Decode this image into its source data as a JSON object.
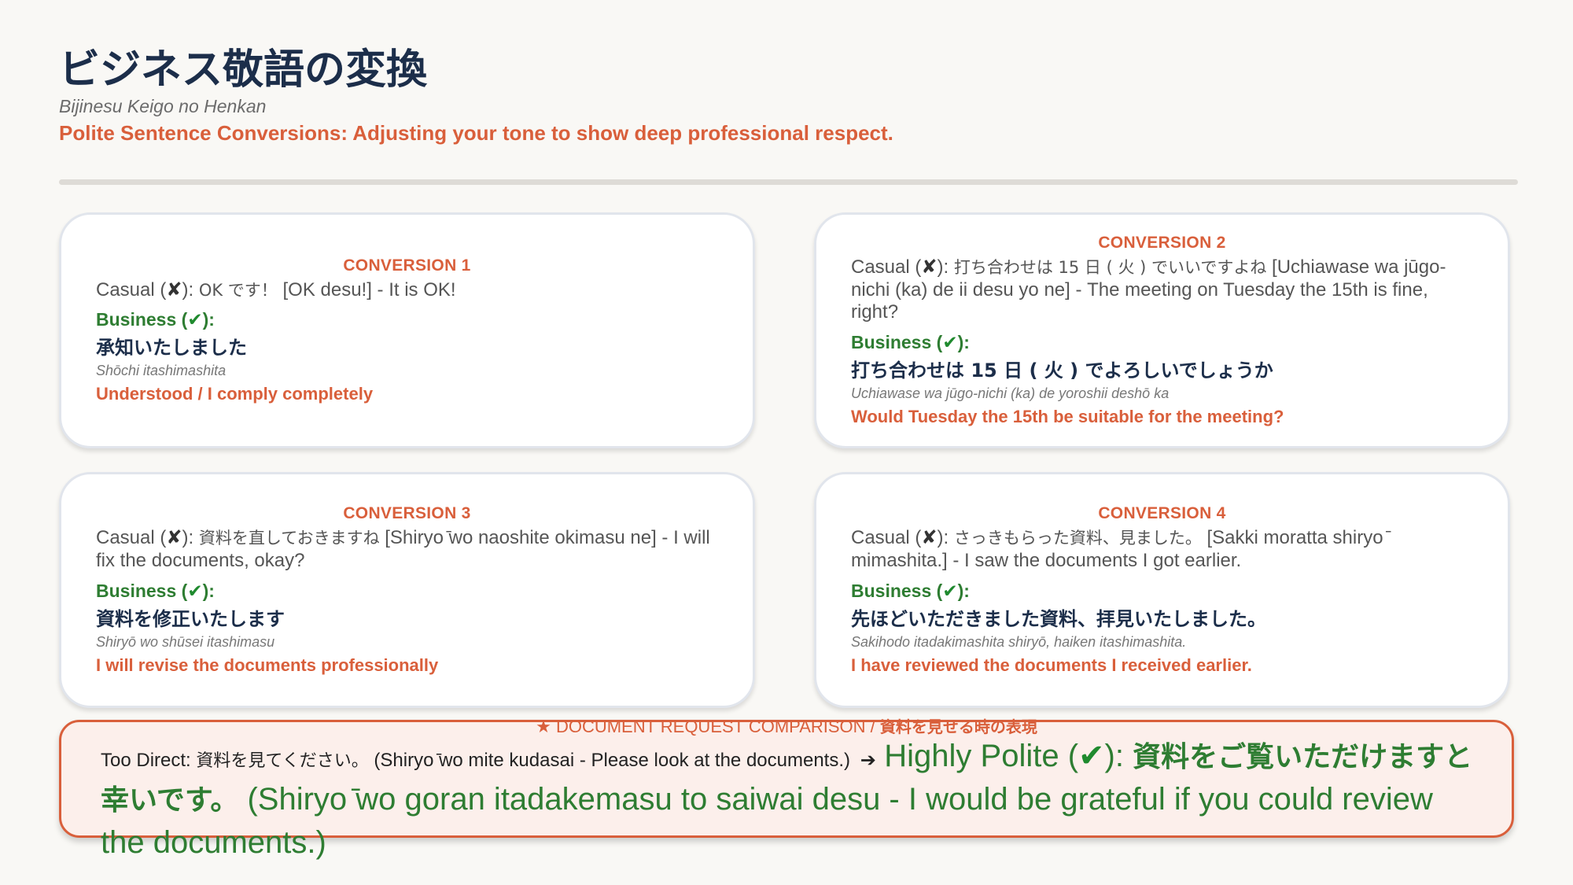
{
  "header": {
    "title": "ビジネス敬語の変換",
    "romaji": "Bijinesu Keigo no Henkan",
    "subtitle": "Polite Sentence Conversions: Adjusting your tone to show deep professional respect."
  },
  "labels": {
    "casual_prefix": "Casual (",
    "mark_suffix": "):",
    "business_prefix": "Business (",
    "cross_mark": "✘",
    "check_mark": "✔"
  },
  "conversions": [
    {
      "label": "CONVERSION 1",
      "casual_jp": "OK です！",
      "casual_rest": "[OK desu!] - It is OK!",
      "business_jp": "承知いたしました",
      "business_romaji": "Shōchi itashimashita",
      "business_en": "Understood / I comply completely"
    },
    {
      "label": "CONVERSION 2",
      "casual_jp": "打ち合わせは 15 日 ( 火 ) でいいですよね",
      "casual_rest": "[Uchiawase wa jūgo-nichi (ka) de ii desu yo ne] - The meeting on Tuesday the 15th is fine, right?",
      "business_jp": "打ち合わせは 15 日 ( 火 ) でよろしいでしょうか",
      "business_romaji": "Uchiawase wa jūgo-nichi (ka) de yoroshii deshō ka",
      "business_en": "Would Tuesday the 15th be suitable for the meeting?"
    },
    {
      "label": "CONVERSION 3",
      "casual_jp": "資料を直しておきますね",
      "casual_rest": "[Shiryo ̄wo naoshite okimasu ne] - I will fix the documents, okay?",
      "business_jp": "資料を修正いたします",
      "business_romaji": "Shiryō wo shūsei itashimasu",
      "business_en": "I will revise the documents professionally"
    },
    {
      "label": "CONVERSION 4",
      "casual_jp": "さっきもらった資料、見ました。",
      "casual_rest": "[Sakki moratta shiryo ̄ mimashita.] - I saw the documents I got earlier.",
      "business_jp": "先ほどいただきました資料、拝見いたしました。",
      "business_romaji": "Sakihodo itadakimashita shiryō, haiken itashimashita.",
      "business_en": "I have reviewed the documents I received earlier."
    }
  ],
  "comparison": {
    "header_en": "★ DOCUMENT REQUEST COMPARISON /",
    "header_jp": "資料を見せる時の表現",
    "too_direct_label": "Too Direct:",
    "too_direct_jp": "資料を見てください。",
    "too_direct_rest": "(Shiryo ̄wo mite kudasai - Please look at the documents.)",
    "arrow": "➔",
    "polite_label_prefix": "Highly Polite (",
    "polite_jp": "資料をご覧いただけますと幸いです。",
    "polite_rest": "(Shiryo ̄wo goran itadakemasu to saiwai desu - I would be grateful if you could review the documents.)"
  },
  "colors": {
    "title": "#1c2e4a",
    "accent": "#d95f3b",
    "business_green": "#2e7d32",
    "background": "#f9f8f5"
  }
}
